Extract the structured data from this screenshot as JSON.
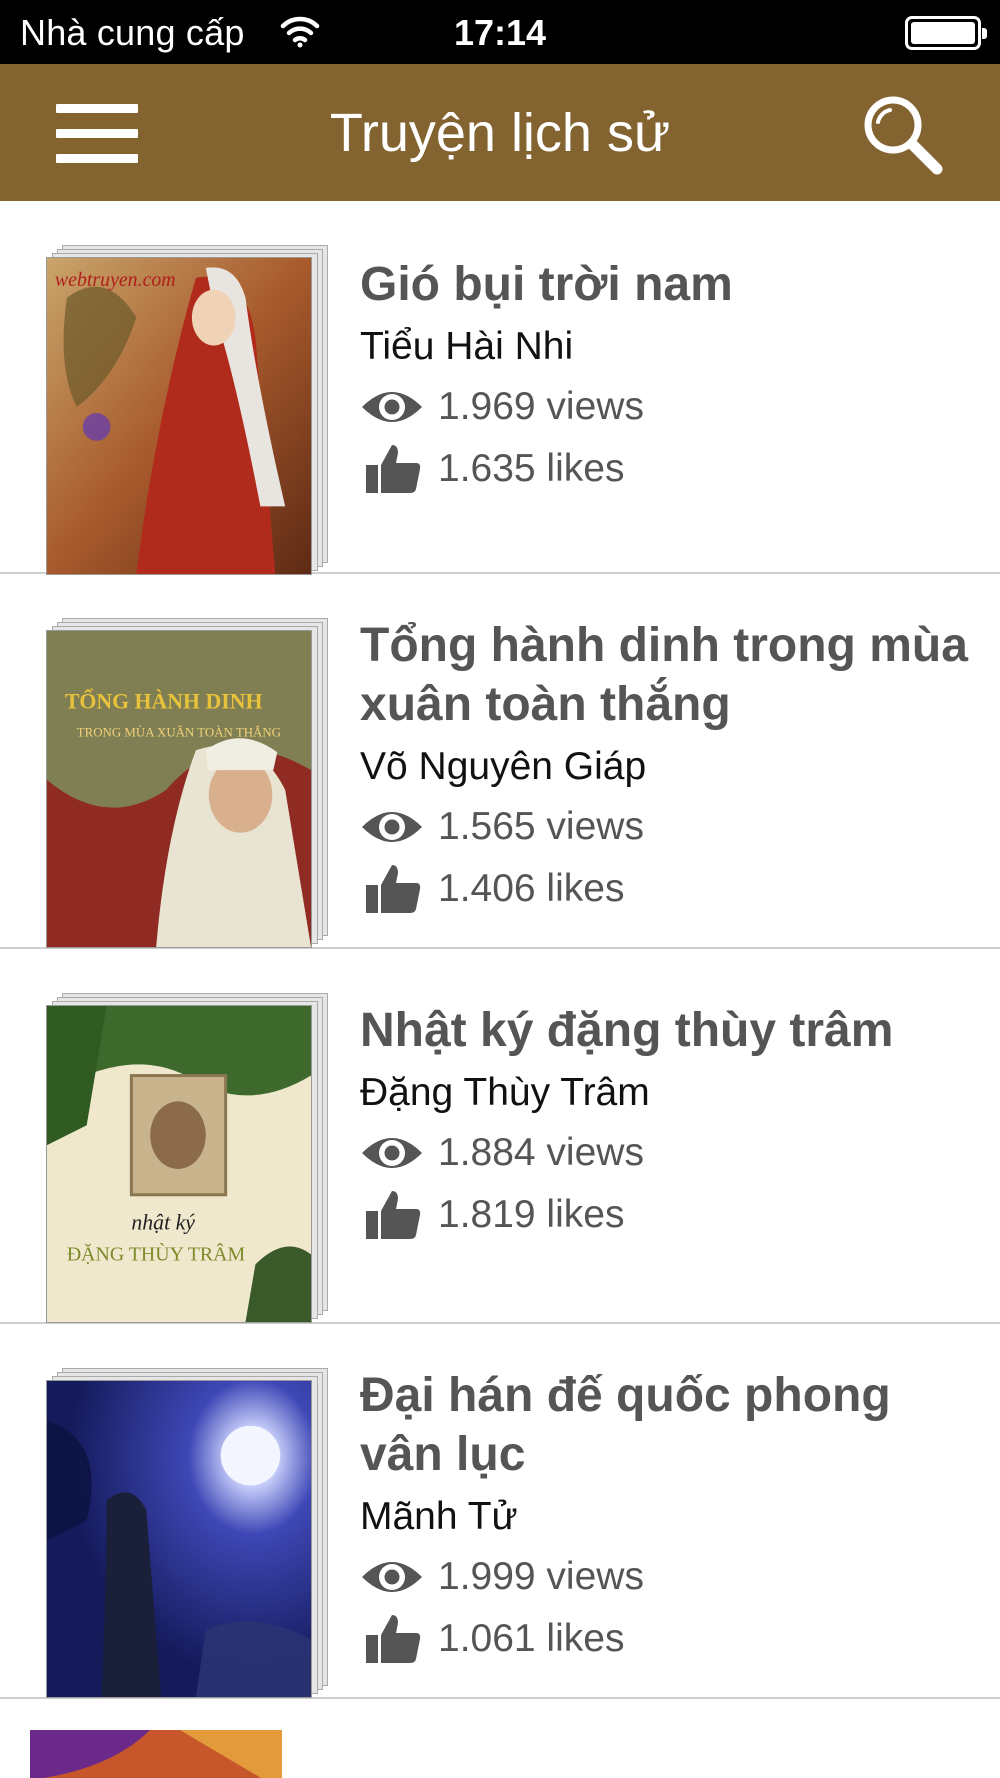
{
  "status_bar": {
    "carrier": "Nhà cung cấp",
    "time": "17:14"
  },
  "nav": {
    "title": "Truyện lịch sử"
  },
  "books": [
    {
      "title": "Gió bụi trời nam",
      "author": "Tiểu Hài Nhi",
      "views": "1.969 views",
      "likes": "1.635 likes",
      "cover_text": "webtruyen.com"
    },
    {
      "title": "Tổng hành dinh trong mùa xuân toàn thắng",
      "author": "Võ Nguyên Giáp",
      "views": "1.565 views",
      "likes": "1.406 likes",
      "cover_text": "TỔNG HÀNH DINH",
      "cover_subtext": "TRONG MÙA XUÂN TOÀN THẮNG"
    },
    {
      "title": "Nhật ký đặng thùy trâm",
      "author": "Đặng Thùy Trâm",
      "views": "1.884 views",
      "likes": "1.819 likes",
      "cover_text": "nhật ký",
      "cover_subtext": "ĐẶNG THÙY TRÂM"
    },
    {
      "title": "Đại hán đế quốc phong vân lục",
      "author": "Mãnh Tử",
      "views": "1.999 views",
      "likes": "1.061 likes"
    }
  ],
  "colors": {
    "nav_background": "#836330",
    "title_text": "#555555",
    "divider": "#cfcfcf"
  }
}
